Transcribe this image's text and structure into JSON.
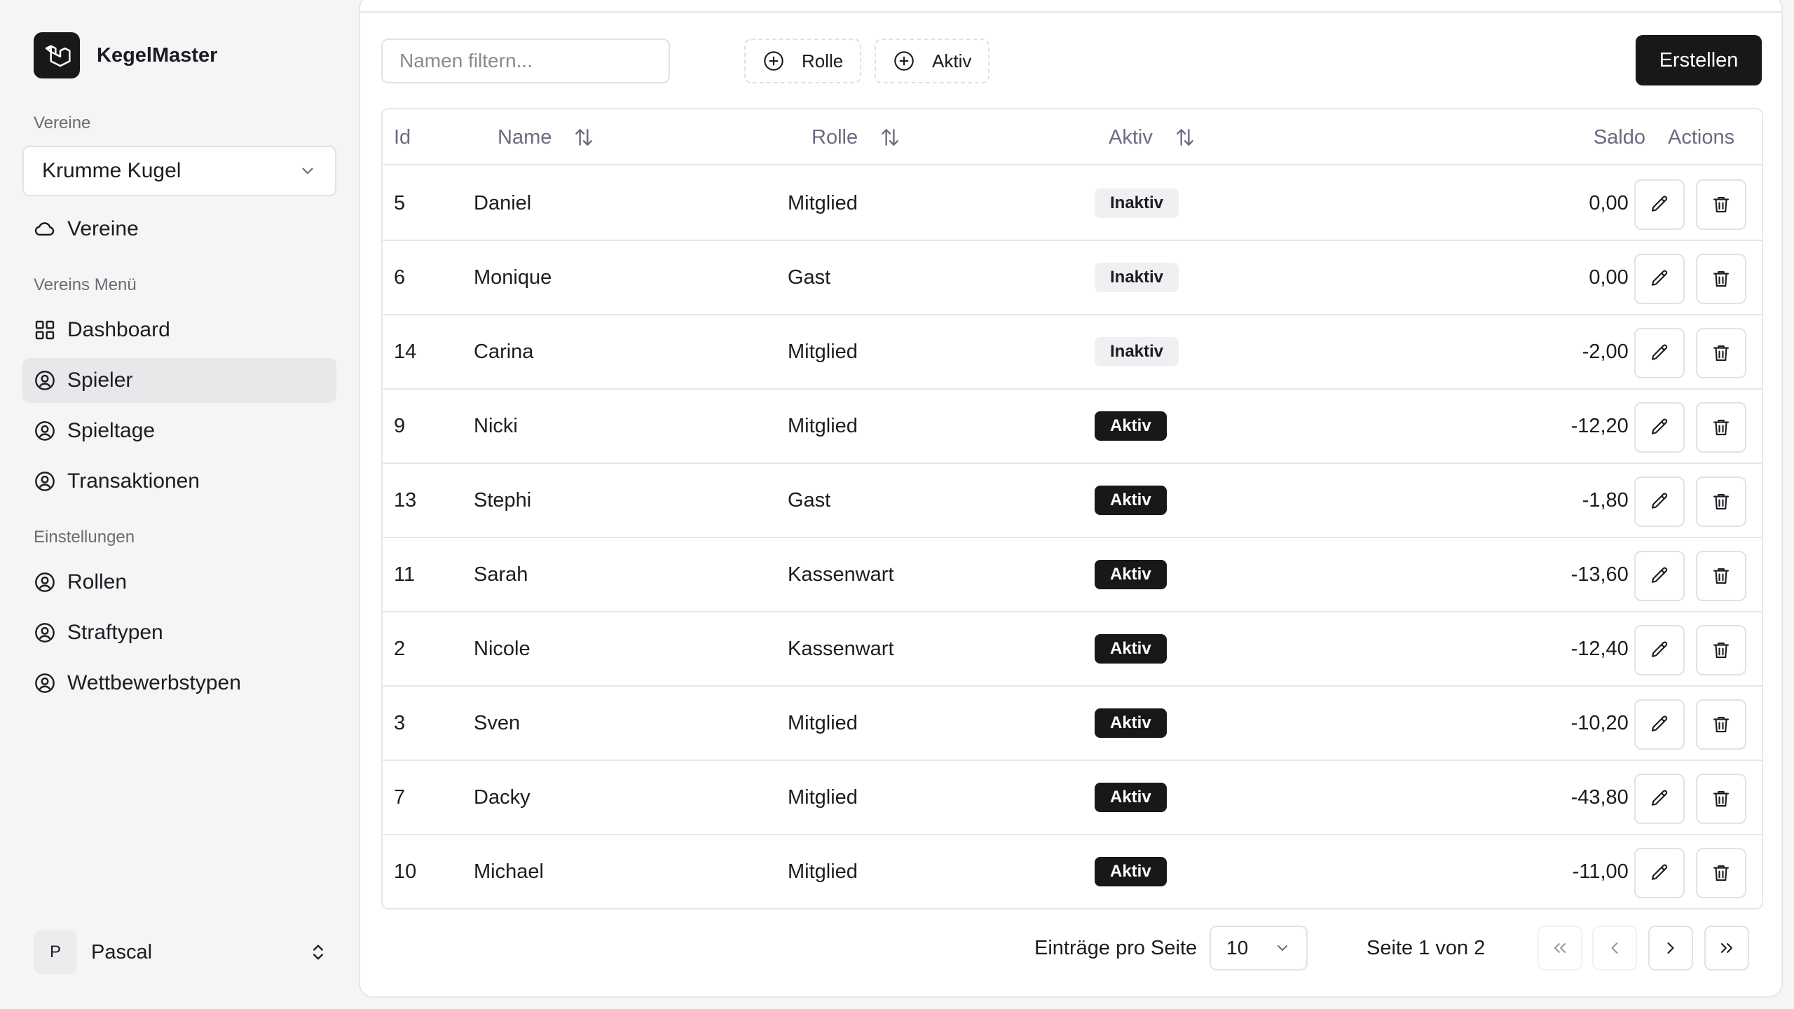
{
  "app": {
    "name": "KegelMaster"
  },
  "sidebar": {
    "clubs_label": "Vereine",
    "club_select": {
      "value": "Krumme Kugel"
    },
    "clubs_link": "Vereine",
    "club_menu_label": "Vereins Menü",
    "club_menu": [
      {
        "label": "Dashboard",
        "icon": "dashboard-icon",
        "active": false
      },
      {
        "label": "Spieler",
        "icon": "user-circle-icon",
        "active": true
      },
      {
        "label": "Spieltage",
        "icon": "user-circle-icon",
        "active": false
      },
      {
        "label": "Transaktionen",
        "icon": "user-circle-icon",
        "active": false
      }
    ],
    "settings_label": "Einstellungen",
    "settings_menu": [
      {
        "label": "Rollen",
        "icon": "user-circle-icon"
      },
      {
        "label": "Straftypen",
        "icon": "user-circle-icon"
      },
      {
        "label": "Wettbewerbstypen",
        "icon": "user-circle-icon"
      }
    ],
    "user": {
      "initial": "P",
      "name": "Pascal"
    }
  },
  "toolbar": {
    "filter_placeholder": "Namen filtern...",
    "role_filter_label": "Rolle",
    "active_filter_label": "Aktiv",
    "create_label": "Erstellen"
  },
  "table": {
    "columns": {
      "id": "Id",
      "name": "Name",
      "role": "Rolle",
      "active": "Aktiv",
      "balance": "Saldo",
      "actions": "Actions"
    },
    "rows": [
      {
        "id": "5",
        "name": "Daniel",
        "role": "Mitglied",
        "status": "Inaktiv",
        "active": false,
        "balance": "0,00 €"
      },
      {
        "id": "6",
        "name": "Monique",
        "role": "Gast",
        "status": "Inaktiv",
        "active": false,
        "balance": "0,00 €"
      },
      {
        "id": "14",
        "name": "Carina",
        "role": "Mitglied",
        "status": "Inaktiv",
        "active": false,
        "balance": "-2,00 €"
      },
      {
        "id": "9",
        "name": "Nicki",
        "role": "Mitglied",
        "status": "Aktiv",
        "active": true,
        "balance": "-12,20 €"
      },
      {
        "id": "13",
        "name": "Stephi",
        "role": "Gast",
        "status": "Aktiv",
        "active": true,
        "balance": "-1,80 €"
      },
      {
        "id": "11",
        "name": "Sarah",
        "role": "Kassenwart",
        "status": "Aktiv",
        "active": true,
        "balance": "-13,60 €"
      },
      {
        "id": "2",
        "name": "Nicole",
        "role": "Kassenwart",
        "status": "Aktiv",
        "active": true,
        "balance": "-12,40 €"
      },
      {
        "id": "3",
        "name": "Sven",
        "role": "Mitglied",
        "status": "Aktiv",
        "active": true,
        "balance": "-10,20 €"
      },
      {
        "id": "7",
        "name": "Dacky",
        "role": "Mitglied",
        "status": "Aktiv",
        "active": true,
        "balance": "-43,80 €"
      },
      {
        "id": "10",
        "name": "Michael",
        "role": "Mitglied",
        "status": "Aktiv",
        "active": true,
        "balance": "-11,00 €"
      }
    ]
  },
  "pagination": {
    "per_page_label": "Einträge pro Seite",
    "per_page_value": "10",
    "page_info": "Seite 1 von 2"
  },
  "colors": {
    "primary": "#18181b",
    "sidebar_bg": "#f5f5f6",
    "border": "#e6e6ea",
    "muted_text": "#6b6b80"
  }
}
